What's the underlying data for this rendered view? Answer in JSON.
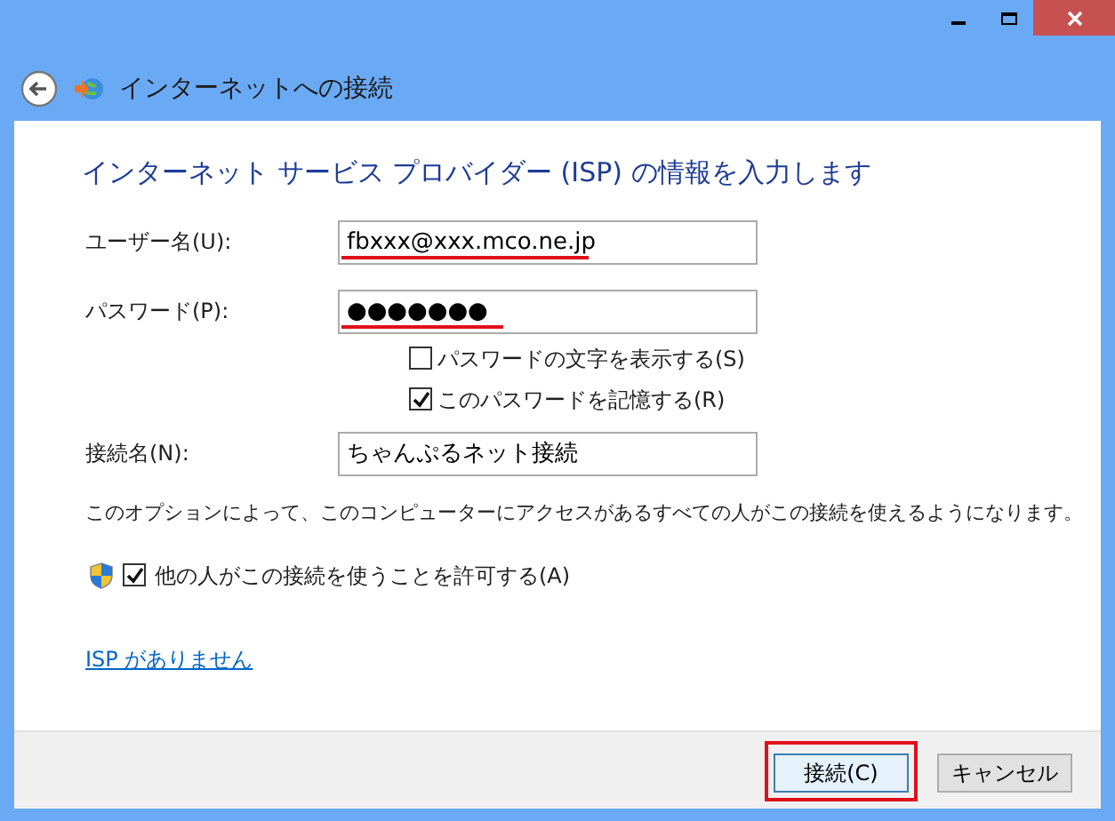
{
  "window": {
    "title": "インターネットへの接続"
  },
  "heading": "インターネット サービス プロバイダー (ISP) の情報を入力します",
  "fields": [
    {
      "label": "ユーザー名(U):",
      "value": "fbxxx@xxx.mco.ne.jp",
      "underlined": true
    },
    {
      "label": "パスワード(P):",
      "value": "●●●●●●●",
      "underlined": true
    }
  ],
  "password_options": [
    {
      "label": "パスワードの文字を表示する(S)",
      "checked": false
    },
    {
      "label": "このパスワードを記憶する(R)",
      "checked": true
    }
  ],
  "connection_name": {
    "label": "接続名(N):",
    "value": "ちゃんぷるネット接続"
  },
  "info": "このオプションによって、このコンピューターにアクセスがあるすべての人がこの接続を使えるようになります。",
  "allow_others": {
    "label": "他の人がこの接続を使うことを許可する(A)",
    "checked": true
  },
  "link": "ISP がありません",
  "buttons": [
    {
      "label": "接続(C)",
      "highlighted": true,
      "default": true
    },
    {
      "label": "キャンセル",
      "highlighted": false,
      "default": false
    }
  ]
}
